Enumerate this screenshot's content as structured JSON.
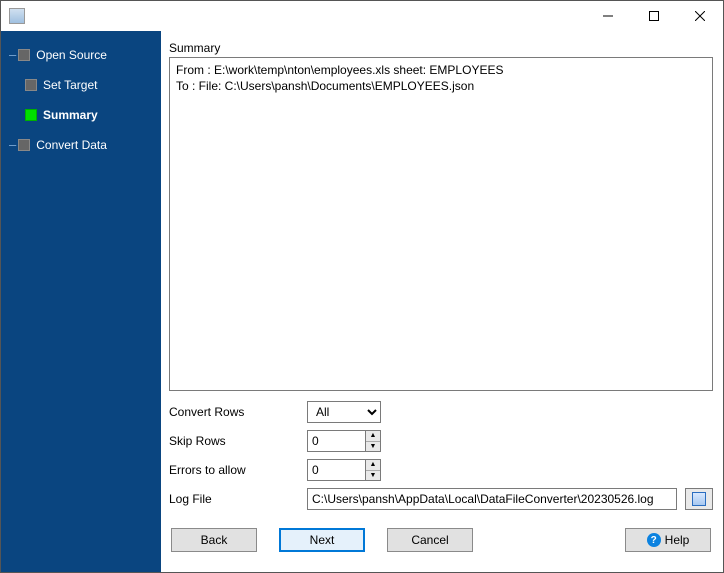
{
  "titlebar": {
    "title": ""
  },
  "sidebar": {
    "items": [
      {
        "label": "Open Source"
      },
      {
        "label": "Set Target"
      },
      {
        "label": "Summary"
      },
      {
        "label": "Convert Data"
      }
    ]
  },
  "main": {
    "section_label": "Summary",
    "summary_lines": {
      "from": "From : E:\\work\\temp\\nton\\employees.xls sheet: EMPLOYEES",
      "to": "To : File: C:\\Users\\pansh\\Documents\\EMPLOYEES.json"
    },
    "form": {
      "convert_rows": {
        "label": "Convert Rows",
        "value": "All"
      },
      "skip_rows": {
        "label": "Skip Rows",
        "value": "0"
      },
      "errors_allow": {
        "label": "Errors to allow",
        "value": "0"
      },
      "log_file": {
        "label": "Log File",
        "value": "C:\\Users\\pansh\\AppData\\Local\\DataFileConverter\\20230526.log"
      }
    }
  },
  "buttons": {
    "back": "Back",
    "next": "Next",
    "cancel": "Cancel",
    "help": "Help"
  }
}
